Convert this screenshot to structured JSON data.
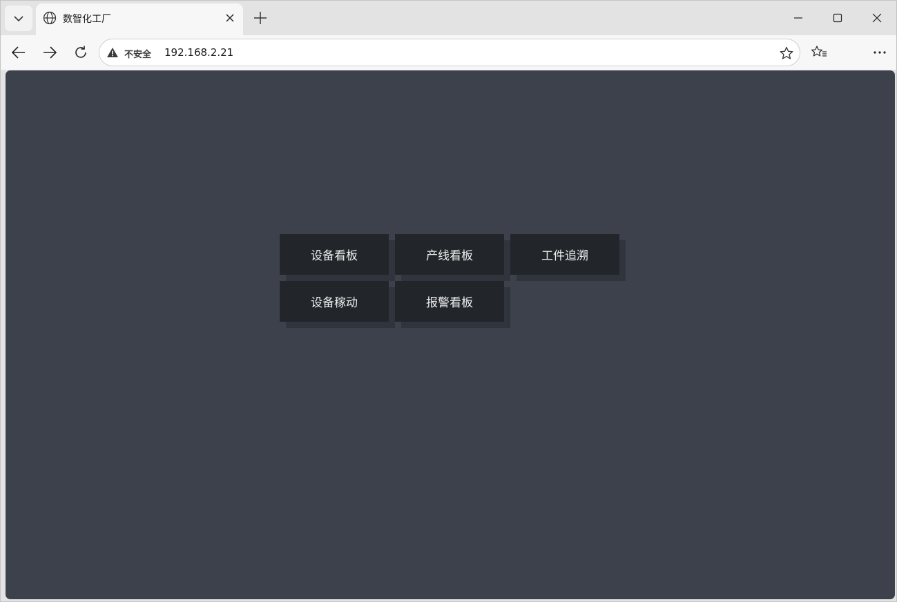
{
  "browser": {
    "tab": {
      "title": "数智化工厂"
    },
    "address": {
      "security_label": "不安全",
      "url": "192.168.2.21"
    }
  },
  "menu": {
    "items": [
      {
        "label": "设备看板"
      },
      {
        "label": "产线看板"
      },
      {
        "label": "工件追溯"
      },
      {
        "label": "设备稼动"
      },
      {
        "label": "报警看板"
      }
    ]
  },
  "colors": {
    "content_background": "#3c414c",
    "tile_background": "#22252a",
    "tile_text": "#eeeeee"
  }
}
